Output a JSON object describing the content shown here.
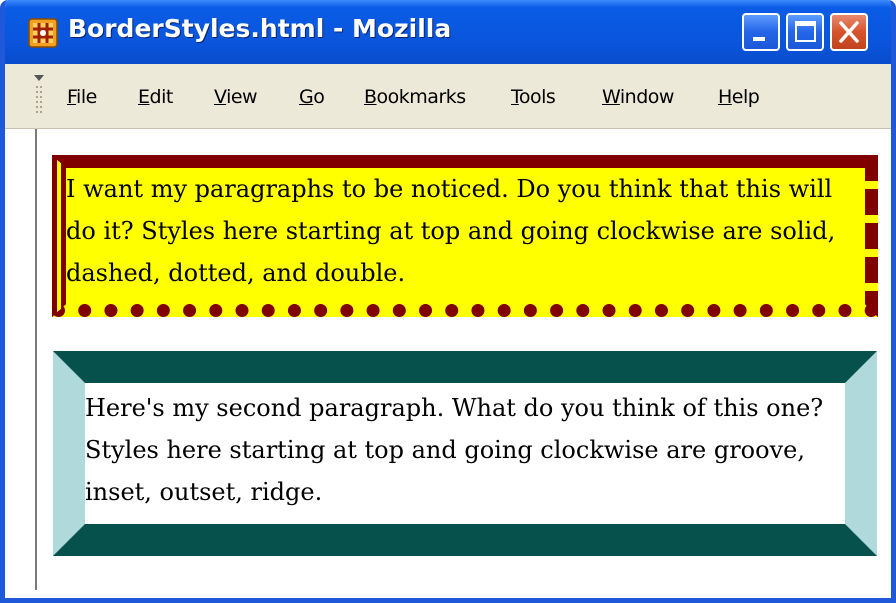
{
  "window": {
    "title": "BorderStyles.html - Mozilla",
    "icon": "mozilla-app-icon",
    "controls": [
      "minimize-icon",
      "maximize-icon",
      "close-icon"
    ]
  },
  "menubar": {
    "items": [
      {
        "label": "File",
        "accesskey": "F"
      },
      {
        "label": "Edit",
        "accesskey": "E"
      },
      {
        "label": "View",
        "accesskey": "V"
      },
      {
        "label": "Go",
        "accesskey": "G"
      },
      {
        "label": "Bookmarks",
        "accesskey": "B"
      },
      {
        "label": "Tools",
        "accesskey": "T"
      },
      {
        "label": "Window",
        "accesskey": "W"
      },
      {
        "label": "Help",
        "accesskey": "H"
      }
    ]
  },
  "content": {
    "paragraph1": {
      "text": "I want my paragraphs to be noticed. Do you think that this will do it? Styles here starting at top and going clockwise are solid, dashed, dotted, and double.",
      "background_color": "#ffff00",
      "border_color": "#800000",
      "border_styles": [
        "solid",
        "dashed",
        "dotted",
        "double"
      ]
    },
    "paragraph2": {
      "text": "Here's my second paragraph. What do you think of this one? Styles here starting at top and going clockwise are groove, inset, outset, ridge.",
      "background_color": "#ffffff",
      "border_dark_color": "#07514d",
      "border_light_color": "#b0d9dc",
      "border_styles": [
        "groove",
        "inset",
        "outset",
        "ridge"
      ]
    }
  },
  "colors": {
    "titlebar_blue": "#0a58e0",
    "menubar_bg": "#ece9d8",
    "close_button_red": "#d6532c"
  }
}
